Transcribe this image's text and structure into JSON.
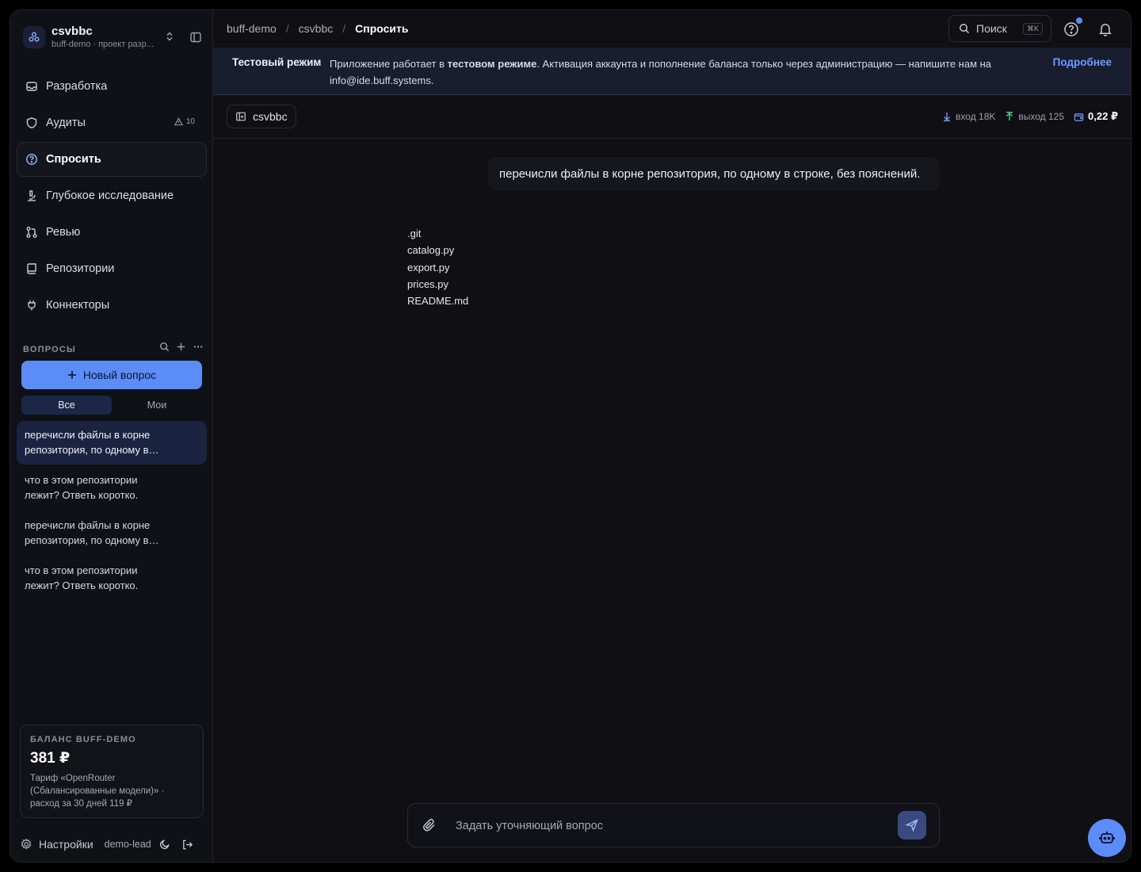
{
  "workspace": {
    "name": "csvbbc",
    "subtitle": "buff-demo · проект разр..."
  },
  "nav": [
    {
      "label": "Разработка",
      "icon": "inbox-icon"
    },
    {
      "label": "Аудиты",
      "icon": "shield-icon",
      "badge": "10"
    },
    {
      "label": "Спросить",
      "icon": "question-circle-icon",
      "active": true
    },
    {
      "label": "Глубокое исследование",
      "icon": "microscope-icon"
    },
    {
      "label": "Ревью",
      "icon": "git-pull-request-icon"
    },
    {
      "label": "Репозитории",
      "icon": "repository-icon"
    },
    {
      "label": "Коннекторы",
      "icon": "plug-icon"
    }
  ],
  "questions": {
    "title": "ВОПРОСЫ",
    "new_button": "Новый вопрос",
    "filters": [
      "Все",
      "Мои"
    ],
    "active_filter": "Все",
    "threads": [
      "перечисли файлы в корне репозитория, по одному в строке, без пояснений.",
      "что в этом репозитории лежит? Ответь коротко.",
      "перечисли файлы в корне репозитория, по одному в строке, без пояснений.",
      "что в этом репозитории лежит? Ответь коротко."
    ]
  },
  "balance": {
    "label": "БАЛАНС BUFF-DEMO",
    "amount": "381 ₽",
    "note": "Тариф «OpenRouter (Сбалансированные модели)» · расход за 30 дней 119 ₽"
  },
  "footer": {
    "settings": "Настройки",
    "user": "demo-lead"
  },
  "breadcrumbs": [
    "buff-demo",
    "csvbbc",
    "Спросить"
  ],
  "search": {
    "label": "Поиск",
    "shortcut": "⌘K"
  },
  "banner": {
    "title": "Тестовый режим",
    "text_before": "Приложение работает в ",
    "text_bold": "тестовом режиме",
    "text_after": ". Активация аккаунта и пополнение баланса только через администрацию — напишите нам на info@ide.buff.systems.",
    "link": "Подробнее"
  },
  "context": {
    "repo": "csvbbc",
    "tokens_in": "вход 18K",
    "tokens_out": "выход 125",
    "cost": "0,22 ₽"
  },
  "conversation": {
    "user_message": "перечисли файлы в корне репозитория, по одному в строке, без пояснений.",
    "answer_lines": [
      ".git",
      "catalog.py",
      "export.py",
      "prices.py",
      "README.md"
    ]
  },
  "composer": {
    "placeholder": "Задать уточняющий вопрос",
    "value": ""
  },
  "colors": {
    "accent": "#5b8cf7",
    "background": "#0f0f14",
    "banner": "#181d30"
  }
}
